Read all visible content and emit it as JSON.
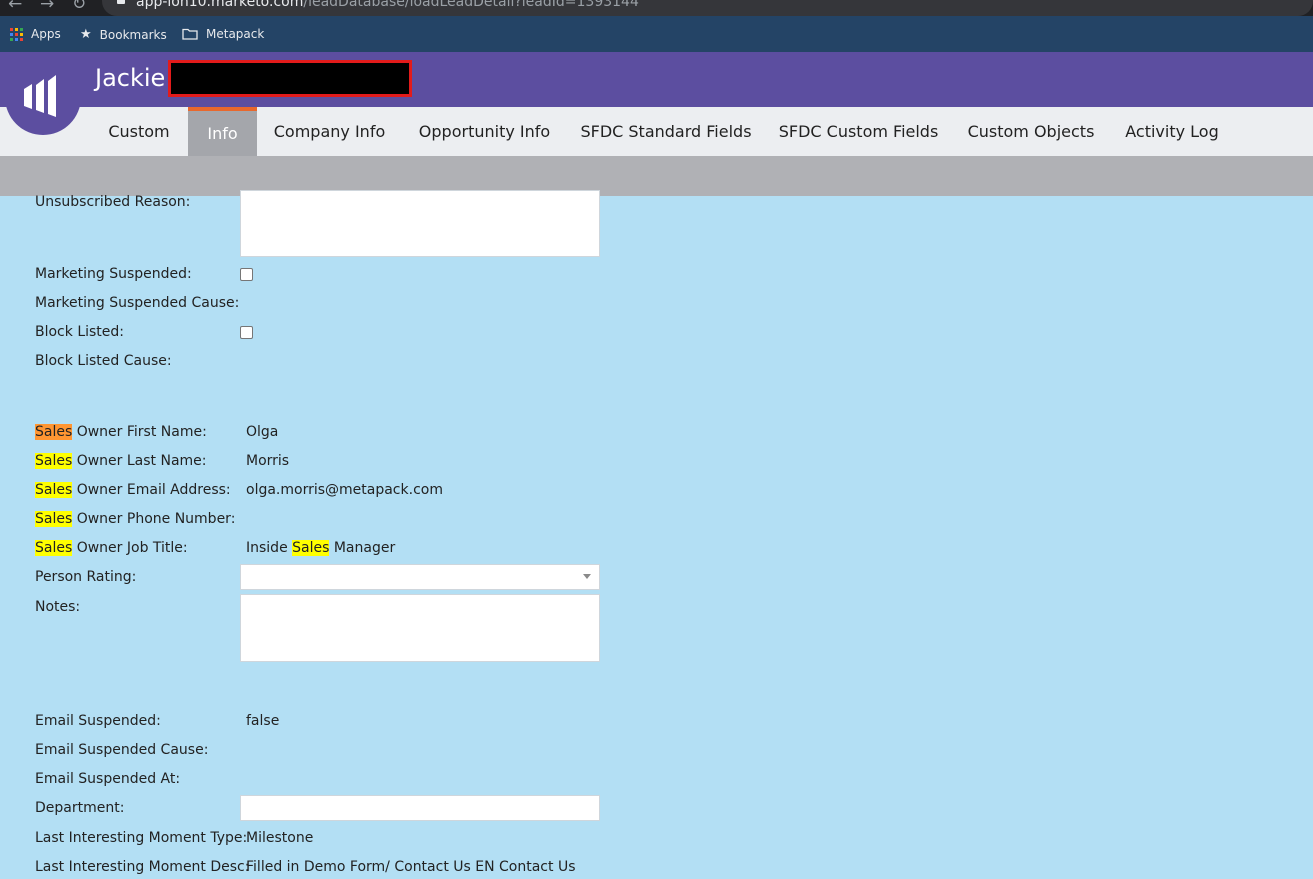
{
  "browser": {
    "url_host": "app-lon10.marketo.com",
    "url_path": "/leadDatabase/loadLeadDetail?leadId=1393144",
    "bookmarks": [
      {
        "label": "Apps",
        "icon": "apps-grid-icon"
      },
      {
        "label": "Bookmarks",
        "icon": "star-icon"
      },
      {
        "label": "Metapack",
        "icon": "folder-icon"
      }
    ]
  },
  "header": {
    "lead_name": "Jackie",
    "bg_color": "#5c4ea0"
  },
  "tabs": [
    "Custom",
    "Info",
    "Company Info",
    "Opportunity Info",
    "SFDC Standard Fields",
    "SFDC Custom Fields",
    "Custom Objects",
    "Activity Log"
  ],
  "active_tab": "Info",
  "search_highlight": "Sales",
  "fields": {
    "unsubscribed_reason": {
      "label": "Unsubscribed Reason:",
      "value": ""
    },
    "marketing_suspended": {
      "label": "Marketing Suspended:",
      "checked": false
    },
    "marketing_suspended_cause": {
      "label": "Marketing Suspended Cause:",
      "value": ""
    },
    "block_listed": {
      "label": "Block Listed:",
      "checked": false
    },
    "block_listed_cause": {
      "label": "Block Listed Cause:",
      "value": ""
    },
    "sales_owner_first_name": {
      "label_rest": " Owner First Name:",
      "value": "Olga"
    },
    "sales_owner_last_name": {
      "label_rest": " Owner Last Name:",
      "value": "Morris"
    },
    "sales_owner_email": {
      "label_rest": " Owner Email Address:",
      "value": "olga.morris@metapack.com"
    },
    "sales_owner_phone": {
      "label_rest": " Owner Phone Number:",
      "value": ""
    },
    "sales_owner_job_title": {
      "label_rest": " Owner Job Title:",
      "value_prefix": "Inside ",
      "value_suffix": " Manager"
    },
    "person_rating": {
      "label": "Person Rating:",
      "value": ""
    },
    "notes": {
      "label": "Notes:",
      "value": ""
    },
    "email_suspended": {
      "label": "Email Suspended:",
      "value": "false"
    },
    "email_suspended_cause": {
      "label": "Email Suspended Cause:",
      "value": ""
    },
    "email_suspended_at": {
      "label": "Email Suspended At:",
      "value": ""
    },
    "department": {
      "label": "Department:",
      "value": ""
    },
    "last_interesting_moment_type": {
      "label": "Last Interesting Moment Type:",
      "value": "Milestone"
    },
    "last_interesting_moment_desc": {
      "label": "Last Interesting Moment Desc:",
      "value": "Filled in Demo Form/ Contact Us EN Contact Us"
    }
  }
}
